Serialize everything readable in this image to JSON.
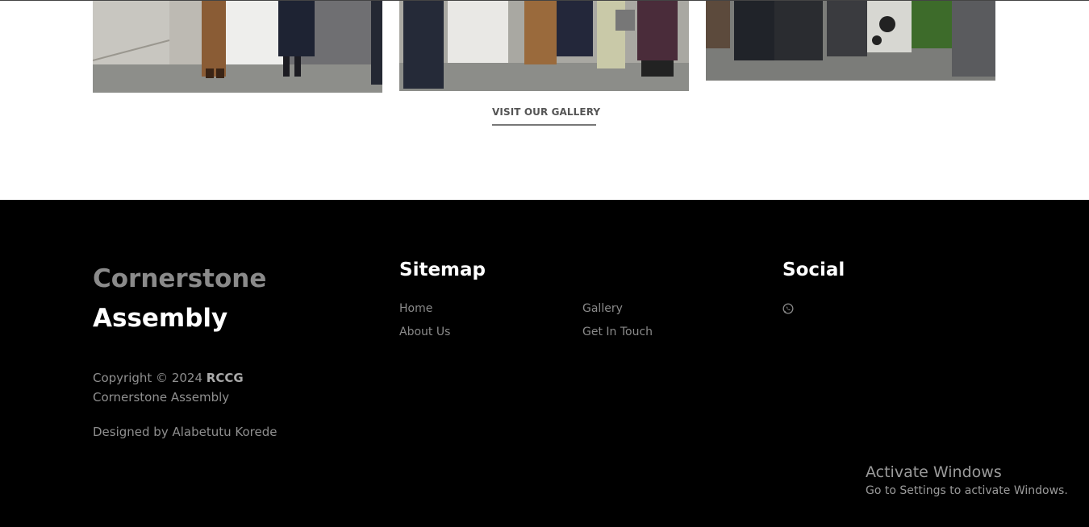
{
  "gallery": {
    "link_label": "VISIT OUR GALLERY",
    "photos": [
      {
        "name": "gallery-photo-1"
      },
      {
        "name": "gallery-photo-2"
      },
      {
        "name": "gallery-photo-3"
      }
    ]
  },
  "footer": {
    "brand_line1": "Cornerstone",
    "brand_line2": "Assembly",
    "copyright_prefix": "Copyright © 2024 ",
    "copyright_bold": "RCCG",
    "copyright_suffix": "Cornerstone Assembly",
    "designed_by": "Designed by Alabetutu Korede",
    "sitemap": {
      "title": "Sitemap",
      "links": [
        "Home",
        "About Us",
        "Gallery",
        "Get In Touch"
      ]
    },
    "social": {
      "title": "Social",
      "icons": [
        "whatsapp-icon"
      ]
    }
  },
  "watermark": {
    "title": "Activate Windows",
    "subtitle": "Go to Settings to activate Windows."
  },
  "colors": {
    "footer_bg": "#000000",
    "brand_gray": "#8a8a8a",
    "link_gray": "#8a8a8a"
  }
}
